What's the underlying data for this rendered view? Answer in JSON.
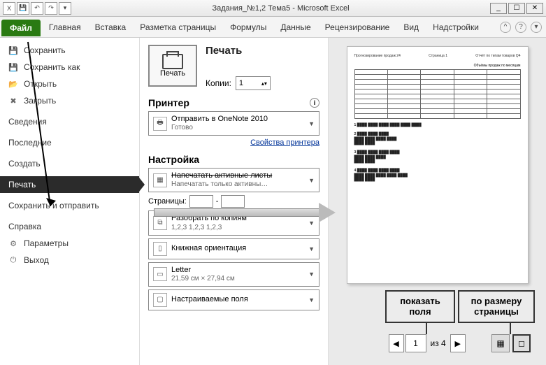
{
  "titlebar": {
    "title": "Задания_№1,2 Тема5 - Microsoft Excel",
    "min": "_",
    "max": "☐",
    "close": "✕"
  },
  "ribbon": {
    "file": "Файл",
    "tabs": [
      "Главная",
      "Вставка",
      "Разметка страницы",
      "Формулы",
      "Данные",
      "Рецензирование",
      "Вид",
      "Надстройки"
    ]
  },
  "sidebar": {
    "save": "Сохранить",
    "save_as": "Сохранить как",
    "open": "Открыть",
    "close": "Закрыть",
    "info": "Сведения",
    "recent": "Последние",
    "new": "Создать",
    "print": "Печать",
    "save_send": "Сохранить и отправить",
    "help": "Справка",
    "options": "Параметры",
    "exit": "Выход"
  },
  "print": {
    "heading": "Печать",
    "button": "Печать",
    "copies_label": "Копии:",
    "copies_value": "1",
    "printer_heading": "Принтер",
    "printer_name": "Отправить в OneNote 2010",
    "printer_status": "Готово",
    "printer_props": "Свойства принтера",
    "settings_heading": "Настройка",
    "active_sheets": "Напечатать активные листы",
    "active_sheets_sub": "Напечатать только активны…",
    "pages_label": "Страницы:",
    "pages_to": "-",
    "collate": "Разобрать по копиям",
    "collate_sub": "1,2,3   1,2,3   1,2,3",
    "orientation": "Книжная ориентация",
    "paper": "Letter",
    "paper_sub": "21,59 см × 27,94 см",
    "margins": "Настраиваемые поля"
  },
  "preview": {
    "nav_prev": "◀",
    "nav_page": "1",
    "nav_of": "из 4",
    "nav_next": "▶",
    "callout_margins": "показать поля",
    "callout_fit": "по размеру страницы",
    "page_header_left": "Прогнозирование продаж 24",
    "page_header_center": "Страница 1",
    "page_header_right": "Отчёт по типам товаров Q4",
    "table_title": "Объёмы продаж по месяцам"
  }
}
